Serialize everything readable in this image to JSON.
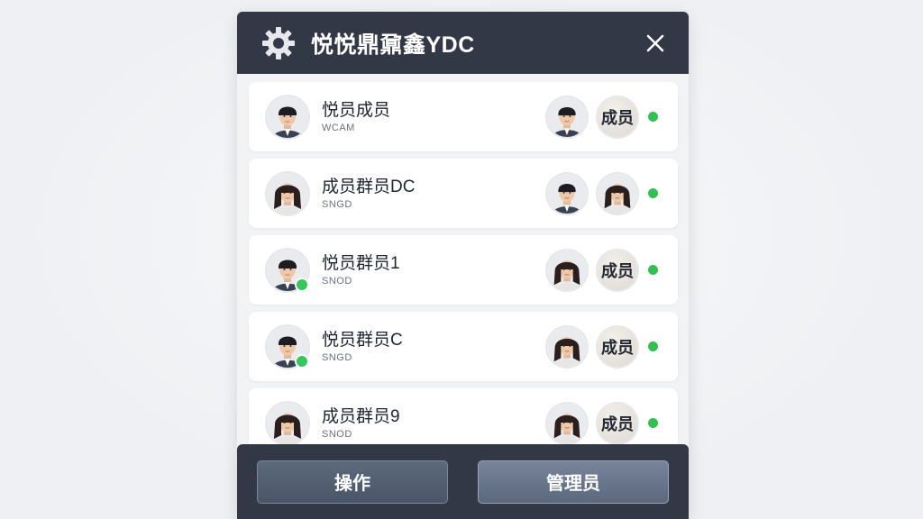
{
  "dialog": {
    "title": "悦悦鼎鼐鑫YDC",
    "icons": {
      "settings": "gear-icon",
      "close": "close-icon"
    }
  },
  "members": [
    {
      "name": "悦员成员",
      "sub": "WCAM",
      "avatar_online": false,
      "peer": "male",
      "tag": "成员",
      "status": "online"
    },
    {
      "name": "成员群员DC",
      "sub": "SNGD",
      "avatar_online": false,
      "peer": "male",
      "tag": "",
      "peer2": "female",
      "status": "online"
    },
    {
      "name": "悦员群员1",
      "sub": "SNOD",
      "avatar_online": true,
      "peer": "female",
      "tag": "成员",
      "status": "online"
    },
    {
      "name": "悦员群员C",
      "sub": "SNGD",
      "avatar_online": true,
      "peer": "female",
      "tag": "成员",
      "status": "online"
    },
    {
      "name": "成员群员9",
      "sub": "SNOD",
      "avatar_online": false,
      "peer": "female",
      "tag": "成员",
      "status": "online"
    }
  ],
  "footer": {
    "operate_label": "操作",
    "admin_label": "管理员"
  },
  "colors": {
    "header_bg": "#323846",
    "online": "#34c759",
    "row_bg": "#ffffff"
  }
}
